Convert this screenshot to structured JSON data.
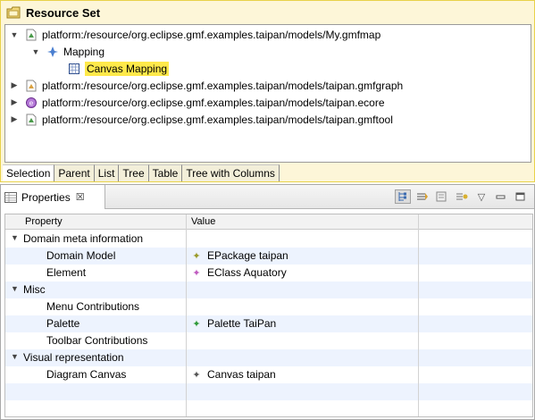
{
  "editor": {
    "title": "Resource Set",
    "tree": [
      {
        "label": "platform:/resource/org.eclipse.gmf.examples.taipan/models/My.gmfmap",
        "expanded": true,
        "icon": "gmfmap-file-icon"
      },
      {
        "label": "Mapping",
        "expanded": true,
        "icon": "mapping-icon"
      },
      {
        "label": "Canvas Mapping",
        "selected": true,
        "icon": "canvas-mapping-icon"
      },
      {
        "label": "platform:/resource/org.eclipse.gmf.examples.taipan/models/taipan.gmfgraph",
        "expanded": false,
        "icon": "gmfgraph-file-icon"
      },
      {
        "label": "platform:/resource/org.eclipse.gmf.examples.taipan/models/taipan.ecore",
        "expanded": false,
        "icon": "ecore-file-icon"
      },
      {
        "label": "platform:/resource/org.eclipse.gmf.examples.taipan/models/taipan.gmftool",
        "expanded": false,
        "icon": "gmftool-file-icon"
      }
    ],
    "tabs": [
      "Selection",
      "Parent",
      "List",
      "Tree",
      "Table",
      "Tree with Columns"
    ]
  },
  "properties": {
    "title": "Properties",
    "close_symbol": "☒",
    "columns": [
      "Property",
      "Value"
    ],
    "rows": [
      {
        "name": "Domain meta information",
        "category": true,
        "value": ""
      },
      {
        "name": "Domain Model",
        "category": false,
        "value": "EPackage taipan",
        "icon_color": "#9a9a2a"
      },
      {
        "name": "Element",
        "category": false,
        "value": "EClass Aquatory",
        "icon_color": "#c05cc0"
      },
      {
        "name": "Misc",
        "category": true,
        "value": ""
      },
      {
        "name": "Menu Contributions",
        "category": false,
        "value": ""
      },
      {
        "name": "Palette",
        "category": false,
        "value": "Palette TaiPan",
        "icon_color": "#2f9a3a"
      },
      {
        "name": "Toolbar Contributions",
        "category": false,
        "value": ""
      },
      {
        "name": "Visual representation",
        "category": true,
        "value": ""
      },
      {
        "name": "Diagram Canvas",
        "category": false,
        "value": "Canvas taipan",
        "icon_color": "#555555"
      }
    ]
  }
}
